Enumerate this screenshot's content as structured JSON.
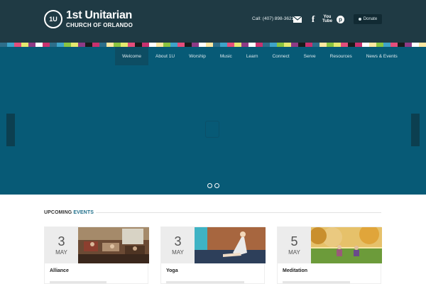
{
  "header": {
    "logo_badge": "1U",
    "logo_line1": "1st Unitarian",
    "logo_line2": "CHURCH OF ORLANDO",
    "contact": "Call: (407) 898-3621",
    "social": [
      "envelope-icon",
      "facebook-icon",
      "youtube-icon",
      "pinterest-icon"
    ],
    "youtube_top": "You",
    "youtube_bottom": "Tube",
    "donate_label": "Donate"
  },
  "colors": {
    "header_bg": "#1f3a44",
    "hero_bg": "#075a76",
    "accent": "#1f6f8b",
    "strip": [
      "#2d6e8a",
      "#e4e86e",
      "#c8316f",
      "#8ac440",
      "#1a1a1a",
      "#ffe7a1",
      "#e44d7b",
      "#ffffff",
      "#3ea3c9",
      "#8e3b86"
    ]
  },
  "nav": {
    "items": [
      {
        "label": "Welcome",
        "active": true
      },
      {
        "label": "About 1U",
        "active": false
      },
      {
        "label": "Worship",
        "active": false
      },
      {
        "label": "Music",
        "active": false
      },
      {
        "label": "Learn",
        "active": false
      },
      {
        "label": "Connect",
        "active": false
      },
      {
        "label": "Serve",
        "active": false
      },
      {
        "label": "Resources",
        "active": false
      },
      {
        "label": "News & Events",
        "active": false
      }
    ]
  },
  "slider": {
    "dots": 2
  },
  "events": {
    "heading_prefix": "UPCOMING",
    "heading_accent": "EVENTS",
    "cards": [
      {
        "day": "3",
        "month": "MAY",
        "title": "Alliance"
      },
      {
        "day": "3",
        "month": "MAY",
        "title": "Yoga"
      },
      {
        "day": "5",
        "month": "MAY",
        "title": "Meditation"
      }
    ]
  }
}
